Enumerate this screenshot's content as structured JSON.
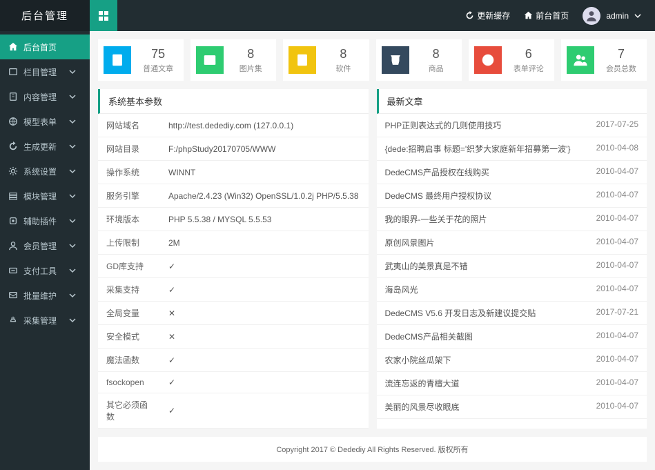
{
  "header": {
    "logo": "后台管理",
    "refresh": "更新缓存",
    "frontend": "前台首页",
    "user": "admin"
  },
  "sidebar": {
    "items": [
      {
        "label": "后台首页",
        "active": true,
        "expandable": false
      },
      {
        "label": "栏目管理",
        "active": false,
        "expandable": true
      },
      {
        "label": "内容管理",
        "active": false,
        "expandable": true
      },
      {
        "label": "模型表单",
        "active": false,
        "expandable": true
      },
      {
        "label": "生成更新",
        "active": false,
        "expandable": true
      },
      {
        "label": "系统设置",
        "active": false,
        "expandable": true
      },
      {
        "label": "模块管理",
        "active": false,
        "expandable": true
      },
      {
        "label": "辅助插件",
        "active": false,
        "expandable": true
      },
      {
        "label": "会员管理",
        "active": false,
        "expandable": true
      },
      {
        "label": "支付工具",
        "active": false,
        "expandable": true
      },
      {
        "label": "批量维护",
        "active": false,
        "expandable": true
      },
      {
        "label": "采集管理",
        "active": false,
        "expandable": true
      }
    ]
  },
  "stats": [
    {
      "num": "75",
      "label": "普通文章",
      "color": "c1"
    },
    {
      "num": "8",
      "label": "图片集",
      "color": "c2"
    },
    {
      "num": "8",
      "label": "软件",
      "color": "c3"
    },
    {
      "num": "8",
      "label": "商品",
      "color": "c4"
    },
    {
      "num": "6",
      "label": "表单评论",
      "color": "c5"
    },
    {
      "num": "7",
      "label": "会员总数",
      "color": "c6"
    }
  ],
  "sysPanel": {
    "title": "系统基本参数",
    "rows": [
      {
        "k": "网站域名",
        "v": "http://test.dedediy.com (127.0.0.1)"
      },
      {
        "k": "网站目录",
        "v": "F:/phpStudy20170705/WWW"
      },
      {
        "k": "操作系统",
        "v": "WINNT"
      },
      {
        "k": "服务引擎",
        "v": "Apache/2.4.23 (Win32) OpenSSL/1.0.2j PHP/5.5.38"
      },
      {
        "k": "环境版本",
        "v": "PHP 5.5.38 / MYSQL 5.5.53"
      },
      {
        "k": "上传限制",
        "v": "2M"
      },
      {
        "k": "GD库支持",
        "v": "✓"
      },
      {
        "k": "采集支持",
        "v": "✓"
      },
      {
        "k": "全局变量",
        "v": "✕"
      },
      {
        "k": "安全模式",
        "v": "✕"
      },
      {
        "k": "魔法函数",
        "v": "✓"
      },
      {
        "k": "fsockopen",
        "v": "✓"
      },
      {
        "k": "其它必须函数",
        "v": "✓"
      }
    ]
  },
  "artPanel": {
    "title": "最新文章",
    "rows": [
      {
        "t": "PHP正则表达式的几则使用技巧",
        "d": "2017-07-25"
      },
      {
        "t": "{dede:招聘启事 标题='织梦大家庭新年招募第一波'}",
        "d": "2010-04-08"
      },
      {
        "t": "DedeCMS产品授权在线购买",
        "d": "2010-04-07"
      },
      {
        "t": "DedeCMS 最终用户授权协议",
        "d": "2010-04-07"
      },
      {
        "t": "我的眼界-一些关于花的照片",
        "d": "2010-04-07"
      },
      {
        "t": "原创风景图片",
        "d": "2010-04-07"
      },
      {
        "t": "武夷山的美景真是不错",
        "d": "2010-04-07"
      },
      {
        "t": "海岛风光",
        "d": "2010-04-07"
      },
      {
        "t": "DedeCMS V5.6 开发日志及新建议提交贴",
        "d": "2017-07-21"
      },
      {
        "t": "DedeCMS产品相关截图",
        "d": "2010-04-07"
      },
      {
        "t": "农家小院丝瓜架下",
        "d": "2010-04-07"
      },
      {
        "t": "流连忘返的青檀大道",
        "d": "2010-04-07"
      },
      {
        "t": "美丽的风景尽收眼底",
        "d": "2010-04-07"
      }
    ]
  },
  "footer": "Copyright 2017 © Dedediy All Rights Reserved. 版权所有"
}
